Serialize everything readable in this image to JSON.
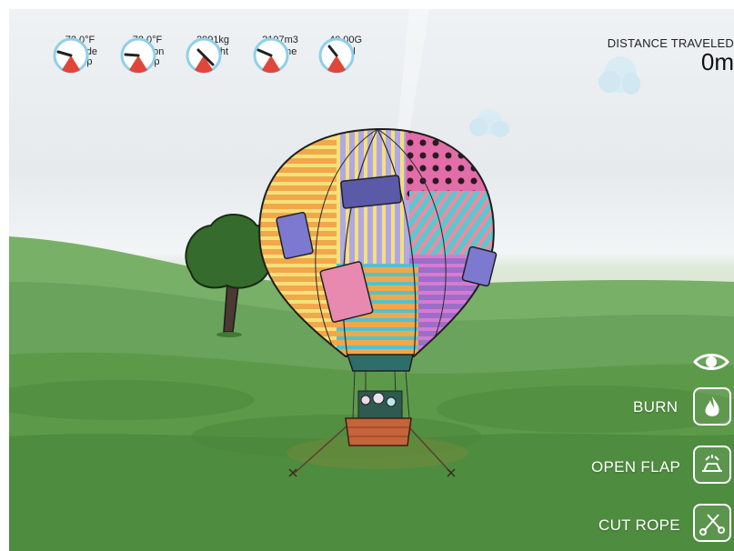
{
  "gauges": [
    {
      "value": "72.0°F",
      "label": "Outside\nTemp",
      "icon": "gauge-icon"
    },
    {
      "value": "72.0°F",
      "label": "Balloon\nTemp",
      "icon": "gauge-icon"
    },
    {
      "value": "2991kg",
      "label": "Weight",
      "icon": "gauge-icon"
    },
    {
      "value": "2197m3",
      "label": "Volume",
      "icon": "gauge-icon"
    },
    {
      "value": "40.00G",
      "label": "Fuel",
      "icon": "gauge-icon"
    }
  ],
  "distance": {
    "title": "DISTANCE TRAVELED",
    "value": "0m"
  },
  "controls": {
    "view_icon": "eye-icon",
    "burn_label": "BURN",
    "burn_icon": "flame-icon",
    "open_flap_label": "OPEN FLAP",
    "open_flap_icon": "flap-icon",
    "cut_rope_label": "CUT ROPE",
    "cut_rope_icon": "scissors-icon"
  },
  "colors": {
    "gauge_ring": "#8fd0e8",
    "gauge_needle": "#222222",
    "gauge_zone": "#e0473a",
    "grass": "#5c9a4a",
    "sky": "#eef2f4"
  }
}
